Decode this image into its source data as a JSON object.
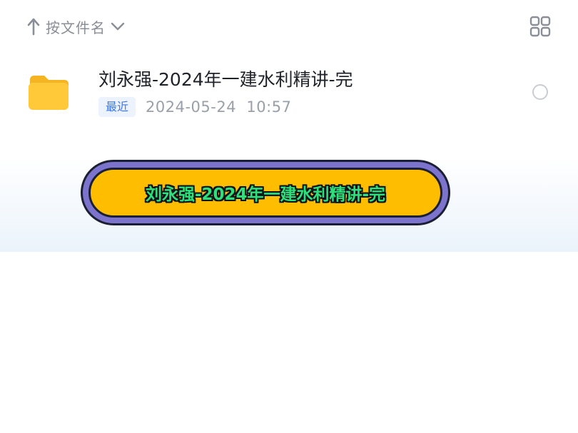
{
  "toolbar": {
    "sort_label": "按文件名",
    "sort_icon": "arrow-up-icon",
    "dropdown_icon": "chevron-down-icon",
    "view_toggle_icon": "grid-view-icon"
  },
  "files": [
    {
      "name": "刘永强-2024年一建水利精讲-完",
      "type_icon": "folder-icon",
      "badge": "最近",
      "modified": "2024-05-24  10:57",
      "selected": false
    }
  ],
  "banner": {
    "text": "刘永强-2024年一建水利精讲-完"
  },
  "colors": {
    "folder": "#ffc93a",
    "badge_text": "#3c78f0",
    "badge_bg": "#edf3fe",
    "banner_fill": "#ffbd00",
    "banner_outline": "#7c73cc",
    "banner_text": "#2ee07a"
  }
}
